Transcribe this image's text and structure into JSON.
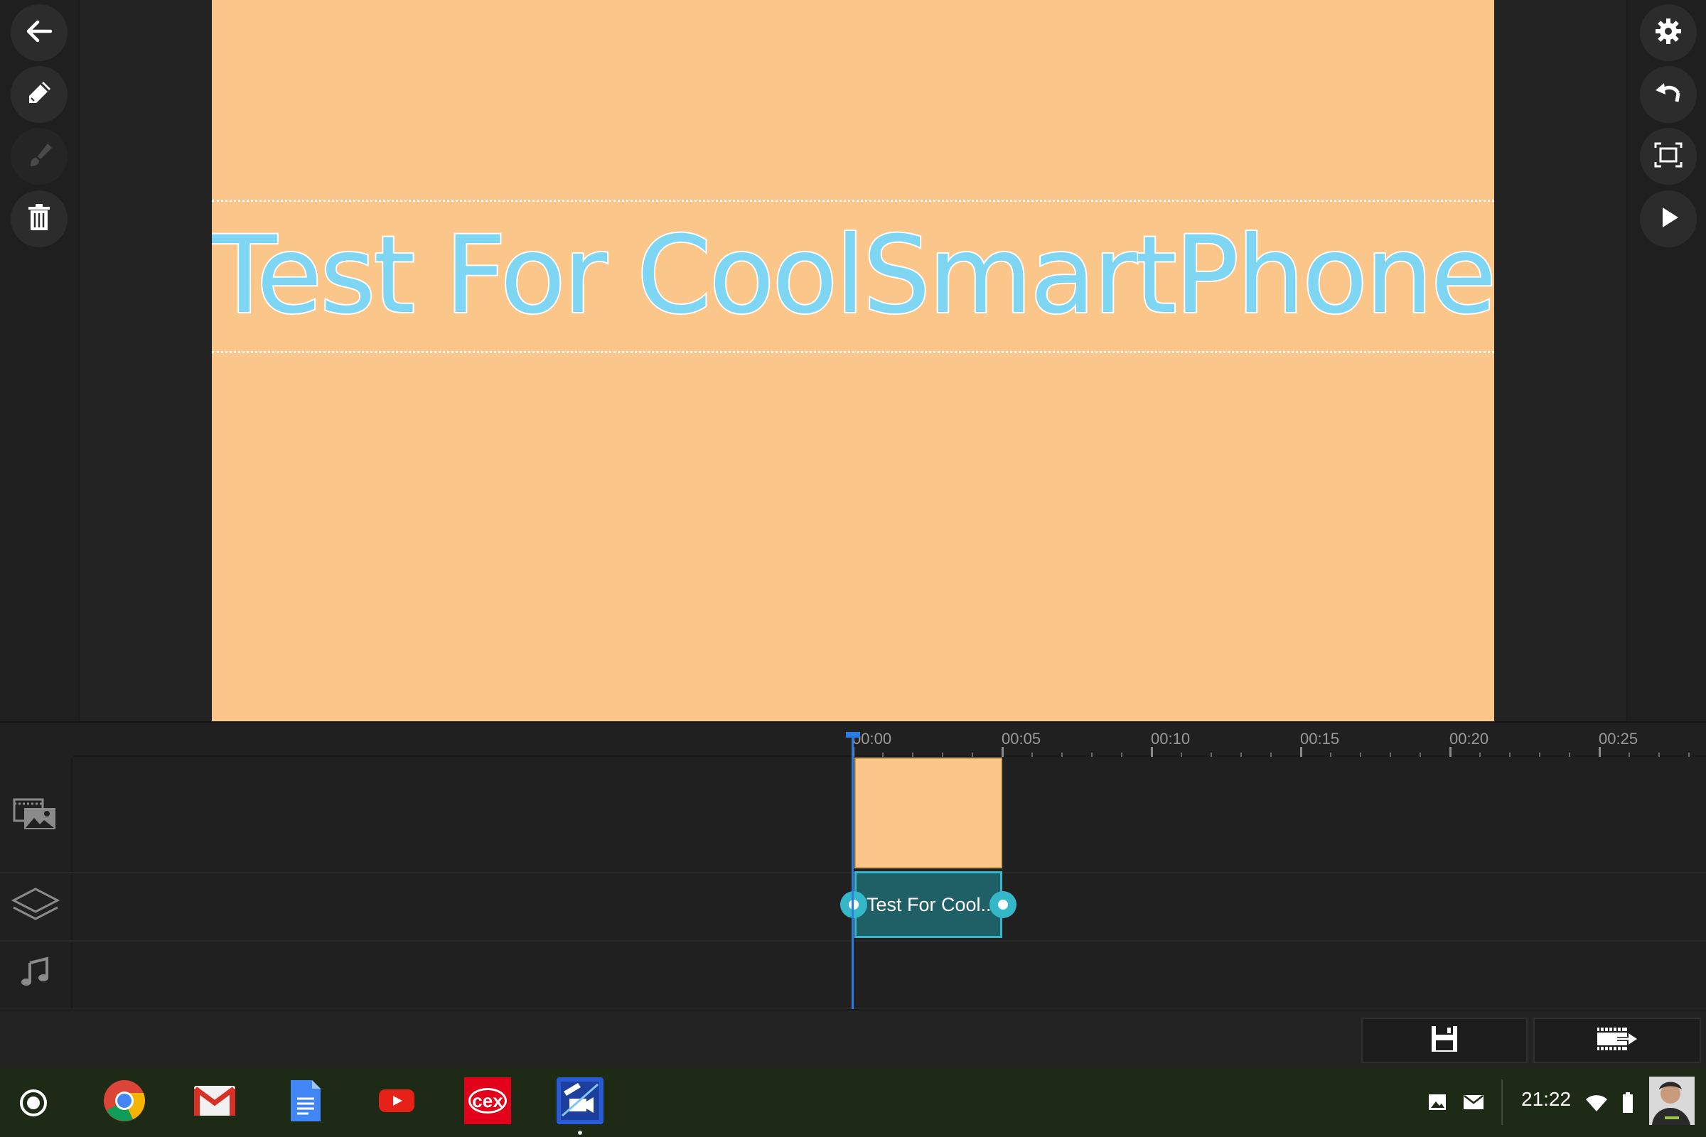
{
  "editor": {
    "preview": {
      "title_text": "Test For CoolSmartPhone",
      "background_color": "#fbc689",
      "text_color": "#7ed6f3"
    },
    "left_tools": [
      "back-arrow-icon",
      "pencil-icon",
      "brush-icon",
      "trash-icon"
    ],
    "right_tools": [
      "gear-icon",
      "undo-icon",
      "fit-screen-icon",
      "play-icon"
    ]
  },
  "timeline": {
    "ruler": [
      "00:00",
      "00:05",
      "00:10",
      "00:15",
      "00:20",
      "00:25"
    ],
    "tracks": [
      "media-track-icon",
      "layers-track-icon",
      "music-track-icon"
    ],
    "text_clip_label": "Test For Cool...",
    "accent_color": "#33b7c9",
    "playhead_color": "#2c7be5"
  },
  "actions": [
    "save-icon",
    "export-video-icon"
  ],
  "shelf": {
    "apps": [
      "chrome",
      "gmail",
      "google-docs",
      "youtube",
      "cex",
      "video-editor"
    ],
    "time": "21:22"
  }
}
